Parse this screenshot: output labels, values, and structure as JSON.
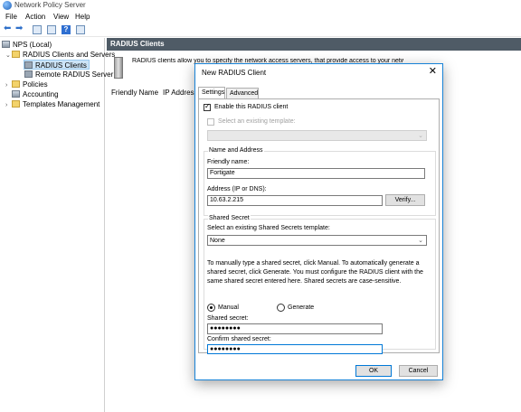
{
  "window": {
    "title": "Network Policy Server"
  },
  "menu": {
    "file": "File",
    "action": "Action",
    "view": "View",
    "help": "Help"
  },
  "tree": {
    "root": "NPS (Local)",
    "radius_group": "RADIUS Clients and Servers",
    "radius_clients": "RADIUS Clients",
    "remote_groups": "Remote RADIUS Server",
    "policies": "Policies",
    "accounting": "Accounting",
    "templates": "Templates Management"
  },
  "pane": {
    "header": "RADIUS Clients",
    "description": "RADIUS clients allow you to specify the network access servers, that provide access to your network.",
    "col_friendly": "Friendly Name",
    "col_ip": "IP Address"
  },
  "dialog": {
    "title": "New RADIUS Client",
    "close_glyph": "✕",
    "tabs": {
      "settings": "Settings",
      "advanced": "Advanced"
    },
    "enable_label": "Enable this RADIUS client",
    "enable_checked": true,
    "template_label": "Select an existing template:",
    "template_value": "",
    "name_address": {
      "group_title": "Name and Address",
      "friendly_label": "Friendly name:",
      "friendly_value": "Fortigate",
      "address_label": "Address (IP or DNS):",
      "address_value": "10.63.2.215",
      "verify_button": "Verify..."
    },
    "shared_secret": {
      "group_title": "Shared Secret",
      "template_label": "Select an existing Shared Secrets template:",
      "template_value": "None",
      "help_text": "To manually type a shared secret, click Manual. To automatically generate a shared secret, click Generate. You must configure the RADIUS client with the same shared secret entered here. Shared secrets are case-sensitive.",
      "manual_label": "Manual",
      "generate_label": "Generate",
      "mode": "manual",
      "secret_label": "Shared secret:",
      "secret_value": "●●●●●●●●",
      "confirm_label": "Confirm shared secret:",
      "confirm_value": "●●●●●●●●"
    },
    "ok_button": "OK",
    "cancel_button": "Cancel"
  }
}
